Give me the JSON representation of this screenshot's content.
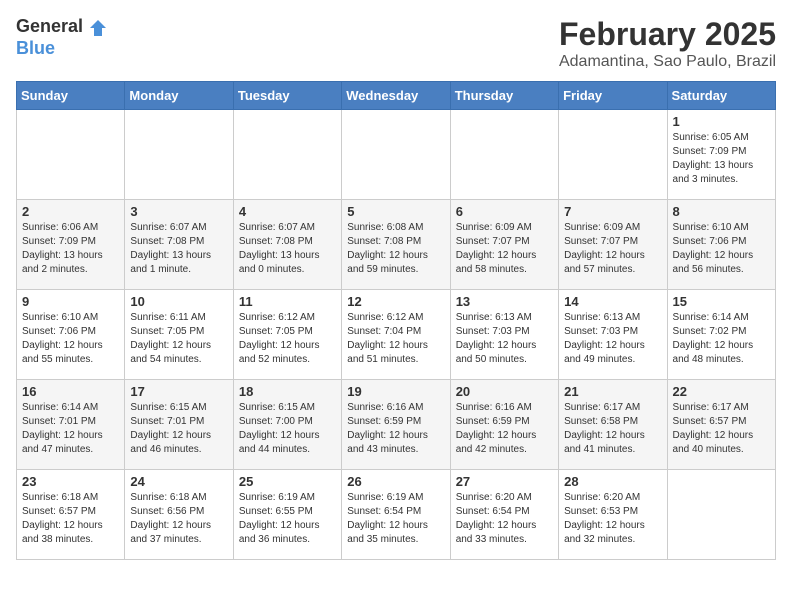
{
  "header": {
    "logo_general": "General",
    "logo_blue": "Blue",
    "month": "February 2025",
    "location": "Adamantina, Sao Paulo, Brazil"
  },
  "weekdays": [
    "Sunday",
    "Monday",
    "Tuesday",
    "Wednesday",
    "Thursday",
    "Friday",
    "Saturday"
  ],
  "weeks": [
    [
      {
        "day": "",
        "info": ""
      },
      {
        "day": "",
        "info": ""
      },
      {
        "day": "",
        "info": ""
      },
      {
        "day": "",
        "info": ""
      },
      {
        "day": "",
        "info": ""
      },
      {
        "day": "",
        "info": ""
      },
      {
        "day": "1",
        "info": "Sunrise: 6:05 AM\nSunset: 7:09 PM\nDaylight: 13 hours and 3 minutes."
      }
    ],
    [
      {
        "day": "2",
        "info": "Sunrise: 6:06 AM\nSunset: 7:09 PM\nDaylight: 13 hours and 2 minutes."
      },
      {
        "day": "3",
        "info": "Sunrise: 6:07 AM\nSunset: 7:08 PM\nDaylight: 13 hours and 1 minute."
      },
      {
        "day": "4",
        "info": "Sunrise: 6:07 AM\nSunset: 7:08 PM\nDaylight: 13 hours and 0 minutes."
      },
      {
        "day": "5",
        "info": "Sunrise: 6:08 AM\nSunset: 7:08 PM\nDaylight: 12 hours and 59 minutes."
      },
      {
        "day": "6",
        "info": "Sunrise: 6:09 AM\nSunset: 7:07 PM\nDaylight: 12 hours and 58 minutes."
      },
      {
        "day": "7",
        "info": "Sunrise: 6:09 AM\nSunset: 7:07 PM\nDaylight: 12 hours and 57 minutes."
      },
      {
        "day": "8",
        "info": "Sunrise: 6:10 AM\nSunset: 7:06 PM\nDaylight: 12 hours and 56 minutes."
      }
    ],
    [
      {
        "day": "9",
        "info": "Sunrise: 6:10 AM\nSunset: 7:06 PM\nDaylight: 12 hours and 55 minutes."
      },
      {
        "day": "10",
        "info": "Sunrise: 6:11 AM\nSunset: 7:05 PM\nDaylight: 12 hours and 54 minutes."
      },
      {
        "day": "11",
        "info": "Sunrise: 6:12 AM\nSunset: 7:05 PM\nDaylight: 12 hours and 52 minutes."
      },
      {
        "day": "12",
        "info": "Sunrise: 6:12 AM\nSunset: 7:04 PM\nDaylight: 12 hours and 51 minutes."
      },
      {
        "day": "13",
        "info": "Sunrise: 6:13 AM\nSunset: 7:03 PM\nDaylight: 12 hours and 50 minutes."
      },
      {
        "day": "14",
        "info": "Sunrise: 6:13 AM\nSunset: 7:03 PM\nDaylight: 12 hours and 49 minutes."
      },
      {
        "day": "15",
        "info": "Sunrise: 6:14 AM\nSunset: 7:02 PM\nDaylight: 12 hours and 48 minutes."
      }
    ],
    [
      {
        "day": "16",
        "info": "Sunrise: 6:14 AM\nSunset: 7:01 PM\nDaylight: 12 hours and 47 minutes."
      },
      {
        "day": "17",
        "info": "Sunrise: 6:15 AM\nSunset: 7:01 PM\nDaylight: 12 hours and 46 minutes."
      },
      {
        "day": "18",
        "info": "Sunrise: 6:15 AM\nSunset: 7:00 PM\nDaylight: 12 hours and 44 minutes."
      },
      {
        "day": "19",
        "info": "Sunrise: 6:16 AM\nSunset: 6:59 PM\nDaylight: 12 hours and 43 minutes."
      },
      {
        "day": "20",
        "info": "Sunrise: 6:16 AM\nSunset: 6:59 PM\nDaylight: 12 hours and 42 minutes."
      },
      {
        "day": "21",
        "info": "Sunrise: 6:17 AM\nSunset: 6:58 PM\nDaylight: 12 hours and 41 minutes."
      },
      {
        "day": "22",
        "info": "Sunrise: 6:17 AM\nSunset: 6:57 PM\nDaylight: 12 hours and 40 minutes."
      }
    ],
    [
      {
        "day": "23",
        "info": "Sunrise: 6:18 AM\nSunset: 6:57 PM\nDaylight: 12 hours and 38 minutes."
      },
      {
        "day": "24",
        "info": "Sunrise: 6:18 AM\nSunset: 6:56 PM\nDaylight: 12 hours and 37 minutes."
      },
      {
        "day": "25",
        "info": "Sunrise: 6:19 AM\nSunset: 6:55 PM\nDaylight: 12 hours and 36 minutes."
      },
      {
        "day": "26",
        "info": "Sunrise: 6:19 AM\nSunset: 6:54 PM\nDaylight: 12 hours and 35 minutes."
      },
      {
        "day": "27",
        "info": "Sunrise: 6:20 AM\nSunset: 6:54 PM\nDaylight: 12 hours and 33 minutes."
      },
      {
        "day": "28",
        "info": "Sunrise: 6:20 AM\nSunset: 6:53 PM\nDaylight: 12 hours and 32 minutes."
      },
      {
        "day": "",
        "info": ""
      }
    ]
  ]
}
